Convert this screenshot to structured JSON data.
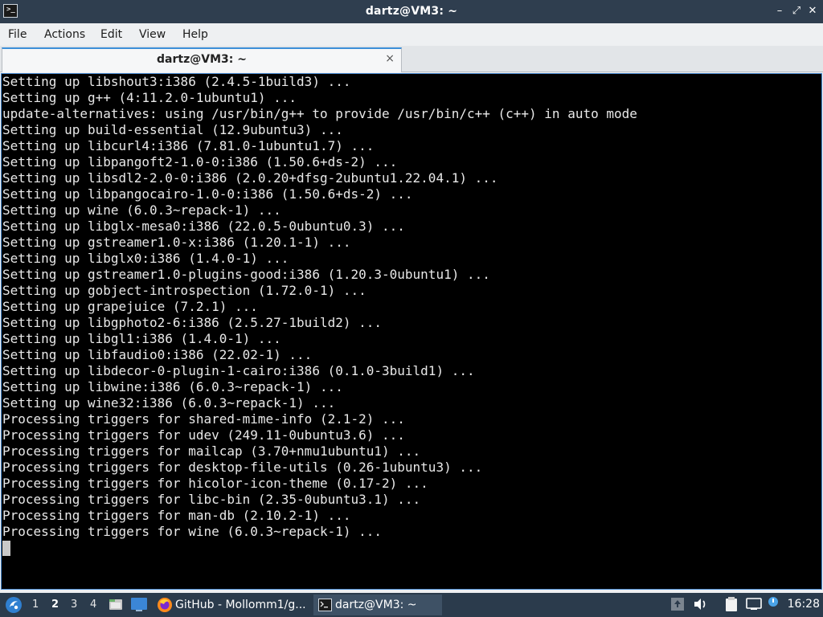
{
  "window": {
    "title": "dartz@VM3: ~",
    "app_icon_glyph": ">_",
    "controls": {
      "minimize": "–",
      "restore": "⤢",
      "close": "✕"
    }
  },
  "menu": {
    "items": [
      {
        "label": "File"
      },
      {
        "label": "Actions"
      },
      {
        "label": "Edit"
      },
      {
        "label": "View"
      },
      {
        "label": "Help"
      }
    ]
  },
  "tabs": [
    {
      "label": "dartz@VM3: ~",
      "close": "×",
      "active": true
    }
  ],
  "terminal": {
    "lines": [
      "Setting up libshout3:i386 (2.4.5-1build3) ...",
      "Setting up g++ (4:11.2.0-1ubuntu1) ...",
      "update-alternatives: using /usr/bin/g++ to provide /usr/bin/c++ (c++) in auto mode",
      "Setting up build-essential (12.9ubuntu3) ...",
      "Setting up libcurl4:i386 (7.81.0-1ubuntu1.7) ...",
      "Setting up libpangoft2-1.0-0:i386 (1.50.6+ds-2) ...",
      "Setting up libsdl2-2.0-0:i386 (2.0.20+dfsg-2ubuntu1.22.04.1) ...",
      "Setting up libpangocairo-1.0-0:i386 (1.50.6+ds-2) ...",
      "Setting up wine (6.0.3~repack-1) ...",
      "Setting up libglx-mesa0:i386 (22.0.5-0ubuntu0.3) ...",
      "Setting up gstreamer1.0-x:i386 (1.20.1-1) ...",
      "Setting up libglx0:i386 (1.4.0-1) ...",
      "Setting up gstreamer1.0-plugins-good:i386 (1.20.3-0ubuntu1) ...",
      "Setting up gobject-introspection (1.72.0-1) ...",
      "Setting up grapejuice (7.2.1) ...",
      "Setting up libgphoto2-6:i386 (2.5.27-1build2) ...",
      "Setting up libgl1:i386 (1.4.0-1) ...",
      "Setting up libfaudio0:i386 (22.02-1) ...",
      "Setting up libdecor-0-plugin-1-cairo:i386 (0.1.0-3build1) ...",
      "Setting up libwine:i386 (6.0.3~repack-1) ...",
      "Setting up wine32:i386 (6.0.3~repack-1) ...",
      "Processing triggers for shared-mime-info (2.1-2) ...",
      "Processing triggers for udev (249.11-0ubuntu3.6) ...",
      "Processing triggers for mailcap (3.70+nmu1ubuntu1) ...",
      "Processing triggers for desktop-file-utils (0.26-1ubuntu3) ...",
      "Processing triggers for hicolor-icon-theme (0.17-2) ...",
      "Processing triggers for libc-bin (2.35-0ubuntu3.1) ...",
      "Processing triggers for man-db (2.10.2-1) ...",
      "Processing triggers for wine (6.0.3~repack-1) ..."
    ]
  },
  "taskbar": {
    "workspaces": [
      "1",
      "2",
      "3",
      "4"
    ],
    "active_workspace": "2",
    "tasks": [
      {
        "label": "GitHub - Mollomm1/g...",
        "icon": "firefox-icon",
        "active": false
      },
      {
        "label": "dartz@VM3: ~",
        "icon": "terminal-icon",
        "active": true
      }
    ],
    "tray_icons": [
      "upload-icon",
      "volume-icon",
      "clipboard-icon",
      "network-icon"
    ],
    "clock": "16:28"
  },
  "colors": {
    "titlebar": "#2f3e4f",
    "accent": "#3c8fd8",
    "terminal_bg": "#000000",
    "terminal_fg": "#e8e8e8",
    "taskbar": "#2b3b4c"
  }
}
